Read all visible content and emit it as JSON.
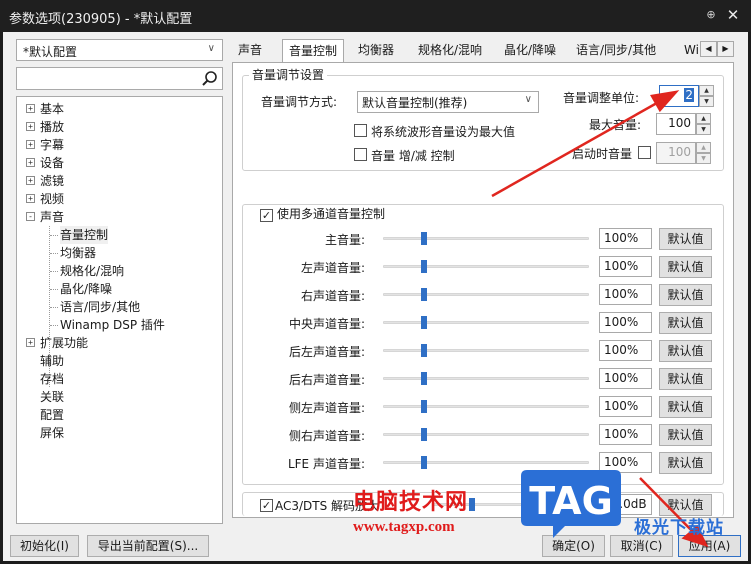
{
  "window": {
    "title": "参数选项(230905) - *默认配置",
    "pin_glyph": "📌",
    "close_glyph": "✕"
  },
  "sidebar": {
    "profile_value": "*默认配置",
    "search_placeholder": "",
    "tree": [
      {
        "label": "基本",
        "expander": "+"
      },
      {
        "label": "播放",
        "expander": "+"
      },
      {
        "label": "字幕",
        "expander": "+"
      },
      {
        "label": "设备",
        "expander": "+"
      },
      {
        "label": "滤镜",
        "expander": "+"
      },
      {
        "label": "视频",
        "expander": "+"
      },
      {
        "label": "声音",
        "expander": "-"
      },
      {
        "label": "音量控制",
        "child": true,
        "selected": true
      },
      {
        "label": "均衡器",
        "child": true
      },
      {
        "label": "规格化/混响",
        "child": true
      },
      {
        "label": "晶化/降噪",
        "child": true
      },
      {
        "label": "语言/同步/其他",
        "child": true
      },
      {
        "label": "Winamp DSP 插件",
        "child": true
      },
      {
        "label": "扩展功能",
        "expander": "+"
      },
      {
        "label": "辅助"
      },
      {
        "label": "存档"
      },
      {
        "label": "关联"
      },
      {
        "label": "配置"
      },
      {
        "label": "屏保"
      }
    ]
  },
  "tabs": [
    {
      "label": "声音"
    },
    {
      "label": "音量控制",
      "active": true
    },
    {
      "label": "均衡器"
    },
    {
      "label": "规格化/混响"
    },
    {
      "label": "晶化/降噪"
    },
    {
      "label": "语言/同步/其他"
    },
    {
      "label": "Wi"
    }
  ],
  "tab_scroll": {
    "left": "◀",
    "right": "▶"
  },
  "volume_settings": {
    "group_title": "音量调节设置",
    "method_label": "音量调节方式:",
    "method_value": "默认音量控制(推荐)",
    "max_waveform_label": "将系统波形音量设为最大值",
    "max_waveform_checked": false,
    "step_label": "音量 增/减 控制",
    "step_checked": false,
    "unit_label": "音量调整单位:",
    "unit_value": "2",
    "max_label": "最大音量:",
    "max_value": "100",
    "startup_label": "启动时音量",
    "startup_checked": false,
    "startup_value": "100"
  },
  "multichannel": {
    "label": "使用多通道音量控制",
    "checked": true,
    "default_label": "默认值",
    "channels": [
      {
        "label": "主音量:",
        "value": "100%",
        "level": 0.2
      },
      {
        "label": "左声道音量:",
        "value": "100%",
        "level": 0.2
      },
      {
        "label": "右声道音量:",
        "value": "100%",
        "level": 0.2
      },
      {
        "label": "中央声道音量:",
        "value": "100%",
        "level": 0.2
      },
      {
        "label": "后左声道音量:",
        "value": "100%",
        "level": 0.2
      },
      {
        "label": "后右声道音量:",
        "value": "100%",
        "level": 0.2
      },
      {
        "label": "侧左声道音量:",
        "value": "100%",
        "level": 0.2
      },
      {
        "label": "侧右声道音量:",
        "value": "100%",
        "level": 0.2
      },
      {
        "label": "LFE 声道音量:",
        "value": "100%",
        "level": 0.2
      }
    ]
  },
  "ac3": {
    "label": "AC3/DTS 解码放大",
    "checked": true,
    "value": "10.0dB",
    "level": 0.25,
    "default_label": "默认值"
  },
  "footer": {
    "init_label": "初始化(I)",
    "export_label": "导出当前配置(S)...",
    "ok_label": "确定(O)",
    "cancel_label": "取消(C)",
    "apply_label": "应用(A)"
  },
  "watermark": {
    "text": "电脑技术网",
    "url": "www.tagxp.com",
    "logo": "TAG",
    "sub": "极光下载站"
  },
  "colors": {
    "accent": "#2f6fc5",
    "annotation": "#e01b1b",
    "logo_blue": "#2b6fd6"
  }
}
